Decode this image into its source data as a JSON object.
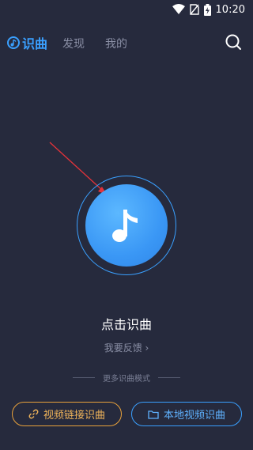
{
  "status_bar": {
    "time": "10:20"
  },
  "top_nav": {
    "brand_label": "识曲",
    "tabs": [
      "发现",
      "我的"
    ]
  },
  "main": {
    "tap_label": "点击识曲",
    "feedback_label": "我要反馈 ›",
    "more_modes_label": "更多识曲模式"
  },
  "actions": {
    "video_link_label": "视频链接识曲",
    "local_video_label": "本地视频识曲"
  },
  "colors": {
    "background": "#262a3d",
    "accent_blue": "#3aa0ff",
    "accent_orange": "#e9a23b"
  }
}
